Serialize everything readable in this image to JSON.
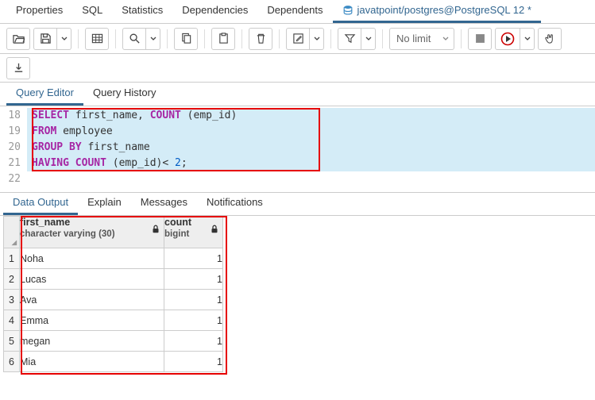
{
  "topTabs": {
    "properties": "Properties",
    "sql": "SQL",
    "statistics": "Statistics",
    "dependencies": "Dependencies",
    "dependents": "Dependents",
    "connection": "javatpoint/postgres@PostgreSQL 12 *"
  },
  "toolbar": {
    "nolimit": "No limit"
  },
  "innerTabs": {
    "queryEditor": "Query Editor",
    "queryHistory": "Query History"
  },
  "editor": {
    "lines": {
      "n18": "18",
      "n19": "19",
      "n20": "20",
      "n21": "21",
      "n22": "22"
    },
    "l18": {
      "a": "SELECT",
      "b": " first_name, ",
      "c": "COUNT",
      "d": " (emp_id)"
    },
    "l19": {
      "a": "FROM",
      "b": " employee"
    },
    "l20": {
      "a": "GROUP BY",
      "b": " first_name"
    },
    "l21": {
      "a": "HAVING COUNT",
      "b": " (emp_id)< ",
      "c": "2",
      "d": ";"
    }
  },
  "outTabs": {
    "data": "Data Output",
    "explain": "Explain",
    "messages": "Messages",
    "notifications": "Notifications"
  },
  "columns": {
    "c0": {
      "name": "first_name",
      "type": "character varying (30)"
    },
    "c1": {
      "name": "count",
      "type": "bigint"
    }
  },
  "rows": {
    "r1": {
      "n": "1",
      "name": "Noha",
      "count": "1"
    },
    "r2": {
      "n": "2",
      "name": "Lucas",
      "count": "1"
    },
    "r3": {
      "n": "3",
      "name": "Ava",
      "count": "1"
    },
    "r4": {
      "n": "4",
      "name": "Emma",
      "count": "1"
    },
    "r5": {
      "n": "5",
      "name": "megan",
      "count": "1"
    },
    "r6": {
      "n": "6",
      "name": "Mia",
      "count": "1"
    }
  }
}
